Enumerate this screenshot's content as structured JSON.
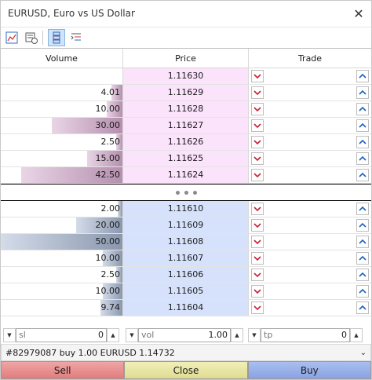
{
  "window": {
    "title": "EURUSD, Euro vs US Dollar"
  },
  "icons": [
    "chart-icon",
    "history-icon",
    "depth-icon",
    "settings-list-icon",
    "close-icon"
  ],
  "columns": {
    "volume": "Volume",
    "price": "Price",
    "trade": "Trade"
  },
  "ask_rows": [
    {
      "volume": "",
      "price": "1.11630",
      "level": 0
    },
    {
      "volume": "4.01",
      "price": "1.11629",
      "level": 0.09
    },
    {
      "volume": "10.00",
      "price": "1.11628",
      "level": 0.13
    },
    {
      "volume": "30.00",
      "price": "1.11627",
      "level": 0.58
    },
    {
      "volume": "2.50",
      "price": "1.11626",
      "level": 0.05
    },
    {
      "volume": "15.00",
      "price": "1.11625",
      "level": 0.29
    },
    {
      "volume": "42.50",
      "price": "1.11624",
      "level": 0.83
    }
  ],
  "bid_rows": [
    {
      "volume": "2.00",
      "price": "1.11610",
      "level": 0.04
    },
    {
      "volume": "20.00",
      "price": "1.11609",
      "level": 0.38
    },
    {
      "volume": "50.00",
      "price": "1.11608",
      "level": 1.0
    },
    {
      "volume": "10.00",
      "price": "1.11607",
      "level": 0.16
    },
    {
      "volume": "2.50",
      "price": "1.11606",
      "level": 0.05
    },
    {
      "volume": "10.00",
      "price": "1.11605",
      "level": 0.16
    },
    {
      "volume": "9.74",
      "price": "1.11604",
      "level": 0.18
    }
  ],
  "controls": {
    "sl": {
      "placeholder": "sl",
      "value": "0"
    },
    "vol": {
      "placeholder": "vol",
      "value": "1.00"
    },
    "tp": {
      "placeholder": "tp",
      "value": "0"
    }
  },
  "order": {
    "text": "#82979087 buy 1.00 EURUSD 1.14732"
  },
  "actions": {
    "sell": "Sell",
    "close": "Close",
    "buy": "Buy"
  },
  "colors": {
    "ask_price_bg": "#fbe3fb",
    "bid_price_bg": "#d6e2fb",
    "sell_arrow": "#c8202f",
    "buy_arrow": "#1f5fbf"
  }
}
